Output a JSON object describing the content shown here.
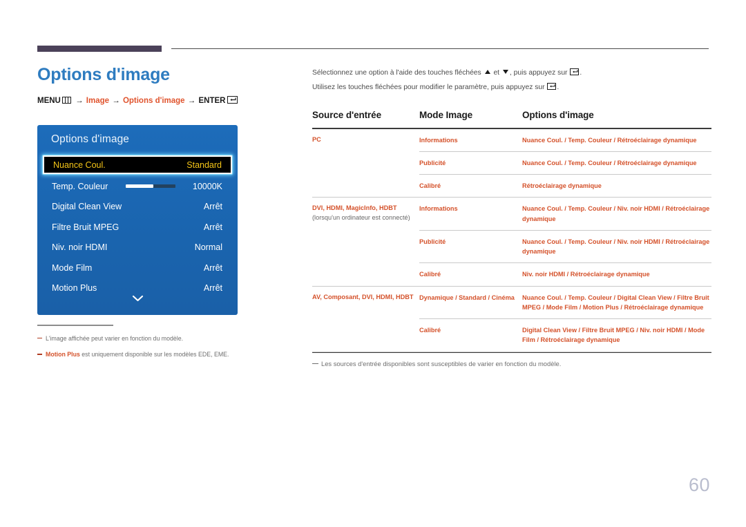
{
  "page": {
    "number": "60",
    "title": "Options d'image"
  },
  "breadcrumb": {
    "menu_label": "MENU",
    "menu_icon": "menu-grid-icon",
    "arrow": "→",
    "item1": "Image",
    "item2": "Options d'image",
    "enter_label": "ENTER",
    "enter_icon": "enter-key-icon"
  },
  "tv_menu": {
    "title": "Options d'image",
    "rows": [
      {
        "label": "Nuance Coul.",
        "value": "Standard",
        "selected": true,
        "type": "value"
      },
      {
        "label": "Temp. Couleur",
        "value": "10000K",
        "selected": false,
        "type": "slider",
        "slider_fill_percent": 55
      },
      {
        "label": "Digital Clean View",
        "value": "Arrêt",
        "selected": false,
        "type": "value"
      },
      {
        "label": "Filtre Bruit MPEG",
        "value": "Arrêt",
        "selected": false,
        "type": "value"
      },
      {
        "label": "Niv. noir HDMI",
        "value": "Normal",
        "selected": false,
        "type": "value"
      },
      {
        "label": "Mode Film",
        "value": "Arrêt",
        "selected": false,
        "type": "value"
      },
      {
        "label": "Motion Plus",
        "value": "Arrêt",
        "selected": false,
        "type": "value"
      }
    ],
    "scroll_icon": "chevron-down-icon",
    "colors": {
      "panel_blue": "#1a69b8",
      "selected_bg": "#000000",
      "selected_text": "#f5c518",
      "glow": "#78dcff"
    }
  },
  "left_notes": [
    {
      "prefix": "",
      "bold": "",
      "text": "L'image affichée peut varier en fonction du modèle."
    },
    {
      "prefix": "",
      "bold": "Motion Plus",
      "text": " est uniquement disponible sur les modèles EDE, EME."
    }
  ],
  "intro": {
    "line1_a": "Sélectionnez une option à l'aide des touches fléchées",
    "line1_icon_up": "arrow-up-icon",
    "line1_b": "et",
    "line1_icon_down": "arrow-down-icon",
    "line1_c": ", puis appuyez sur",
    "line1_icon_enter": "enter-key-icon",
    "line1_d": ".",
    "line2_a": "Utilisez les touches fléchées pour modifier le paramètre, puis appuyez sur",
    "line2_icon_enter": "enter-key-icon",
    "line2_b": "."
  },
  "table": {
    "headers": {
      "col1": "Source d'entrée",
      "col2": "Mode Image",
      "col3": "Options d'image"
    },
    "groups": [
      {
        "source": "PC",
        "source_note": "",
        "rows": [
          {
            "mode": "Informations",
            "options": "Nuance Coul. / Temp. Couleur / Rétroéclairage dynamique"
          },
          {
            "mode": "Publicité",
            "options": "Nuance Coul. / Temp. Couleur / Rétroéclairage dynamique"
          },
          {
            "mode": "Calibré",
            "options": "Rétroéclairage dynamique"
          }
        ]
      },
      {
        "source": "DVI, HDMI, MagicInfo, HDBT",
        "source_note": "(lorsqu'un ordinateur est connecté)",
        "rows": [
          {
            "mode": "Informations",
            "options": "Nuance Coul. / Temp. Couleur / Niv. noir HDMI / Rétroéclairage dynamique"
          },
          {
            "mode": "Publicité",
            "options": "Nuance Coul. / Temp. Couleur / Niv. noir HDMI / Rétroéclairage dynamique"
          },
          {
            "mode": "Calibré",
            "options": "Niv. noir HDMI / Rétroéclairage dynamique"
          }
        ]
      },
      {
        "source": "AV, Composant, DVI, HDMI, HDBT",
        "source_note": "",
        "rows": [
          {
            "mode": "Dynamique / Standard / Cinéma",
            "options": "Nuance Coul. / Temp. Couleur / Digital Clean View / Filtre Bruit MPEG / Mode Film / Motion Plus / Rétroéclairage dynamique"
          },
          {
            "mode": "Calibré",
            "options": "Digital Clean View / Filtre Bruit MPEG / Niv. noir HDMI / Mode Film / Rétroéclairage dynamique"
          }
        ]
      }
    ],
    "footnote": "Les sources d'entrée disponibles sont susceptibles de varier en fonction du modèle."
  },
  "colors": {
    "accent_orange": "#d4512a",
    "title_blue": "#2e7cc0",
    "header_bar": "#4b4159",
    "page_number": "#b9bdce"
  }
}
